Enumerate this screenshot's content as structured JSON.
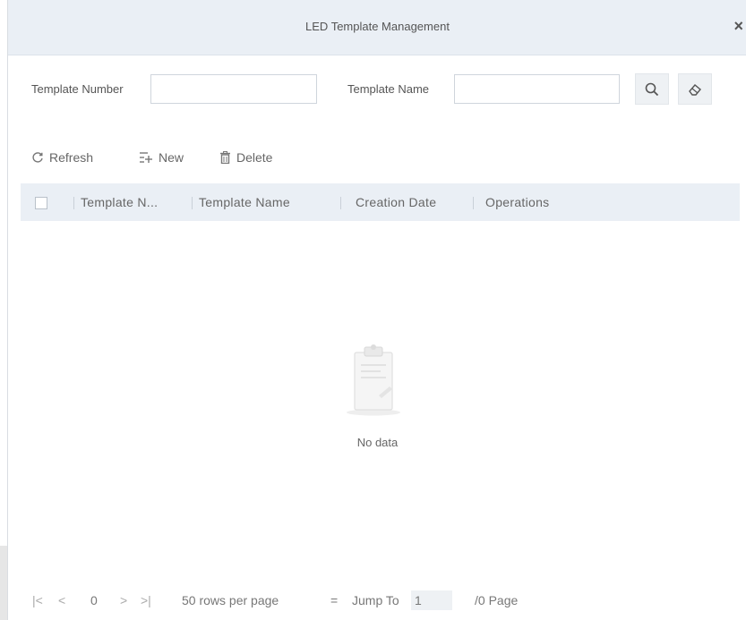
{
  "dialog": {
    "title": "LED Template Management",
    "close_label": "×"
  },
  "search": {
    "template_number_label": "Template Number",
    "template_number_value": "",
    "template_name_label": "Template Name",
    "template_name_value": ""
  },
  "toolbar": {
    "refresh_label": "Refresh",
    "new_label": "New",
    "delete_label": "Delete"
  },
  "table": {
    "columns": [
      "Template N...",
      "Template Name",
      "Creation Date",
      "Operations"
    ],
    "rows": [],
    "empty_text": "No data"
  },
  "pagination": {
    "first": "|<",
    "prev": "<",
    "current_page": "0",
    "next": ">",
    "last": ">|",
    "rows_per_page": "50 rows per page",
    "dropdown_arrow": "=",
    "jump_to_label": "Jump To",
    "jump_value": "1",
    "total_pages": "/0 Page"
  },
  "icons": {
    "search": "search-icon",
    "clear": "eraser-icon",
    "refresh": "refresh-icon",
    "new": "add-icon",
    "delete": "trash-icon",
    "empty": "clipboard-icon"
  },
  "colors": {
    "header_bg": "#eaeff5",
    "button_bg": "#eef1f4",
    "border": "#cfd5dc"
  }
}
